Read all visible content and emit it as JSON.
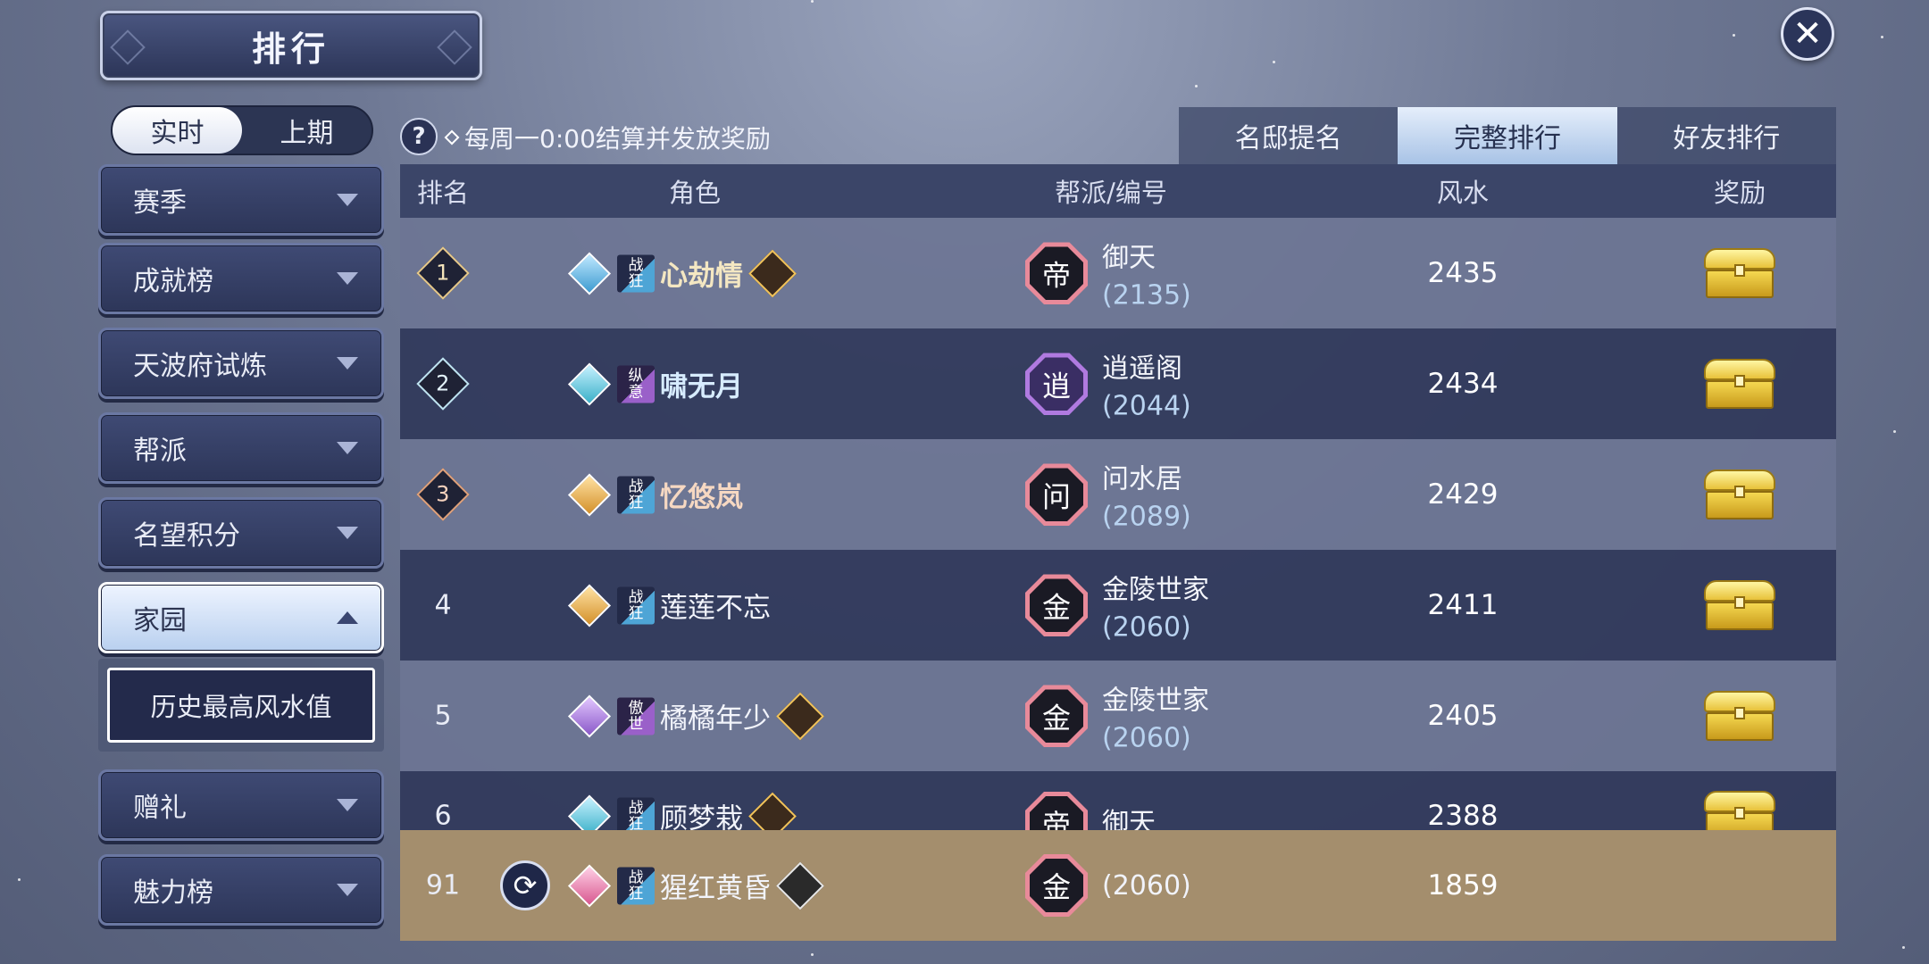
{
  "header": {
    "title": "排行",
    "close_symbol": "✕"
  },
  "period_toggle": {
    "options": [
      "实时",
      "上期"
    ],
    "selected": "实时"
  },
  "notice": {
    "help_symbol": "?",
    "text": "每周一0:00结算并发放奖励"
  },
  "tabs": [
    {
      "label": "名邸提名",
      "active": false
    },
    {
      "label": "完整排行",
      "active": true
    },
    {
      "label": "好友排行",
      "active": false
    }
  ],
  "sidebar": {
    "items": [
      {
        "label": "赛季",
        "expanded": false
      },
      {
        "label": "成就榜",
        "expanded": false
      },
      {
        "label": "天波府试炼",
        "expanded": false
      },
      {
        "label": "帮派",
        "expanded": false
      },
      {
        "label": "名望积分",
        "expanded": false
      },
      {
        "label": "家园",
        "expanded": true
      },
      {
        "label": "赠礼",
        "expanded": false
      },
      {
        "label": "魅力榜",
        "expanded": false
      }
    ],
    "sub_item": "历史最高风水值"
  },
  "table": {
    "columns": [
      "排名",
      "角色",
      "帮派/编号",
      "风水",
      "奖励"
    ],
    "rows": [
      {
        "rank": "1",
        "tag": [
          "战",
          "狂"
        ],
        "name": "心劫情",
        "guild_char": "帝",
        "guild": "御天",
        "guild_id": "(2135)",
        "fengshui": "2435"
      },
      {
        "rank": "2",
        "tag": [
          "纵",
          "意"
        ],
        "name": "啸无月",
        "guild_char": "逍",
        "guild": "逍遥阁",
        "guild_id": "(2044)",
        "fengshui": "2434"
      },
      {
        "rank": "3",
        "tag": [
          "战",
          "狂"
        ],
        "name": "忆悠岚",
        "guild_char": "问",
        "guild": "问水居",
        "guild_id": "(2089)",
        "fengshui": "2429"
      },
      {
        "rank": "4",
        "tag": [
          "战",
          "狂"
        ],
        "name": "莲莲不忘",
        "guild_char": "金",
        "guild": "金陵世家",
        "guild_id": "(2060)",
        "fengshui": "2411"
      },
      {
        "rank": "5",
        "tag": [
          "傲",
          "世"
        ],
        "name": "橘橘年少",
        "guild_char": "金",
        "guild": "金陵世家",
        "guild_id": "(2060)",
        "fengshui": "2405"
      },
      {
        "rank": "6",
        "tag": [
          "战",
          "狂"
        ],
        "name": "顾梦栽",
        "guild_char": "帝",
        "guild": "御天",
        "guild_id": "",
        "fengshui": "2388"
      }
    ],
    "my_row": {
      "rank": "91",
      "tag": [
        "战",
        "狂"
      ],
      "name": "猩红黄昏",
      "guild_char": "金",
      "guild_id": "(2060)",
      "fengshui": "1859",
      "refresh_symbol": "⟳"
    }
  },
  "colors": {
    "panel": "#323a5c",
    "accent_tab": "#a8c3e6",
    "my_row": "#a48e6d",
    "chest_gold": "#f5d851"
  }
}
